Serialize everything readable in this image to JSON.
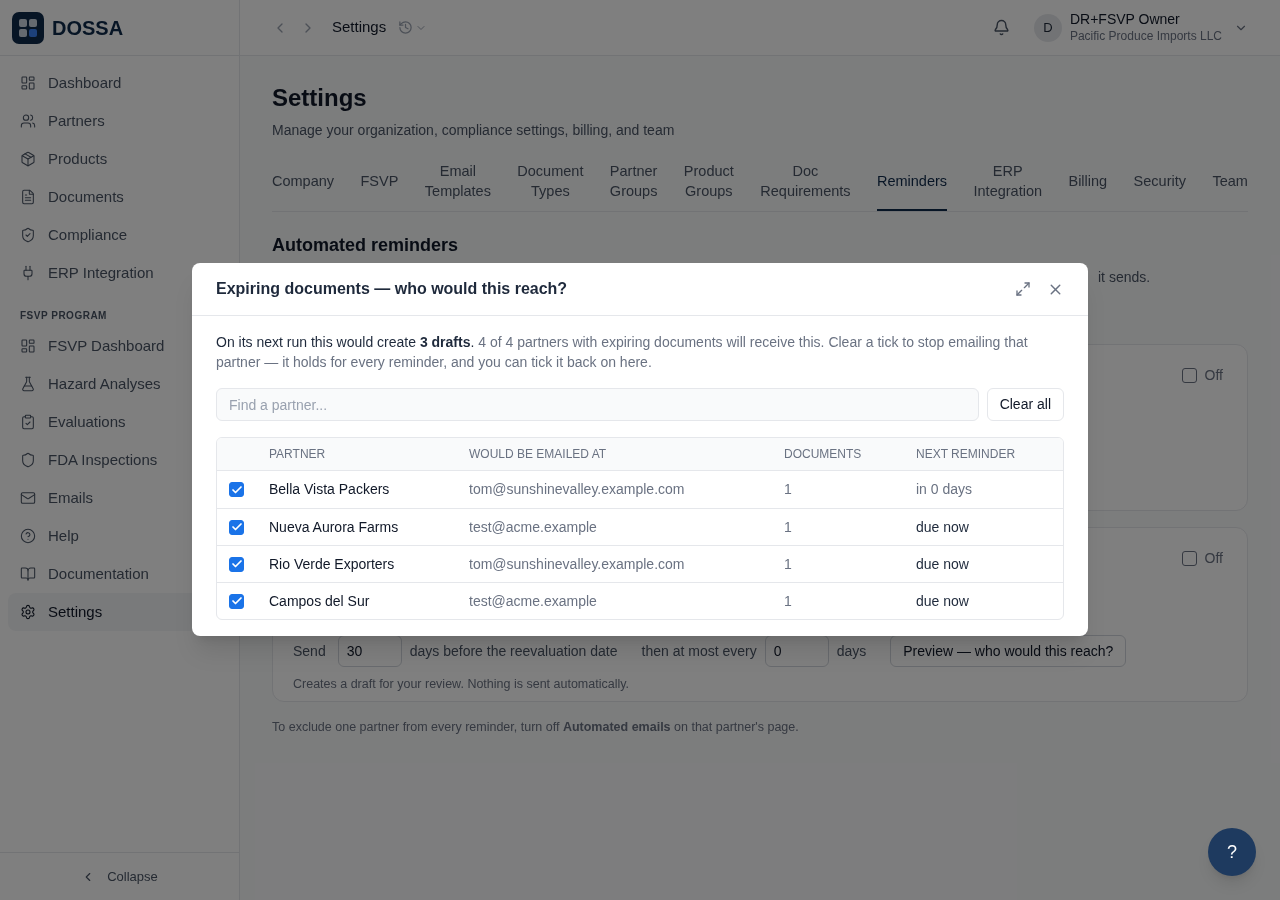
{
  "app": {
    "name": "DOSSA"
  },
  "sidebar": {
    "main_items": [
      {
        "label": "Dashboard",
        "selected": false
      },
      {
        "label": "Partners",
        "selected": false
      },
      {
        "label": "Products",
        "selected": false
      },
      {
        "label": "Documents",
        "selected": false
      },
      {
        "label": "Compliance",
        "selected": false
      },
      {
        "label": "ERP Integration",
        "selected": false
      }
    ],
    "section_heading": "FSVP PROGRAM",
    "program_items": [
      {
        "label": "FSVP Dashboard",
        "selected": false
      },
      {
        "label": "Hazard Analyses",
        "selected": false
      },
      {
        "label": "Evaluations",
        "selected": false
      },
      {
        "label": "FDA Inspections",
        "selected": false
      },
      {
        "label": "Emails",
        "selected": false
      },
      {
        "label": "Help",
        "selected": false
      },
      {
        "label": "Documentation",
        "selected": false
      },
      {
        "label": "Settings",
        "selected": true
      }
    ],
    "collapse_label": "Collapse"
  },
  "header": {
    "title": "Settings",
    "user": {
      "initial": "D",
      "name": "DR+FSVP Owner",
      "org": "Pacific Produce Imports LLC"
    }
  },
  "page": {
    "title": "Settings",
    "subtitle": "Manage your organization, compliance settings, billing, and team",
    "tabs": [
      {
        "label": "Company",
        "selected": false
      },
      {
        "label": "FSVP",
        "selected": false
      },
      {
        "label": "Email Templates",
        "selected": false
      },
      {
        "label": "Document Types",
        "selected": false
      },
      {
        "label": "Partner Groups",
        "selected": false
      },
      {
        "label": "Product Groups",
        "selected": false
      },
      {
        "label": "Doc Requirements",
        "selected": false
      },
      {
        "label": "Reminders",
        "selected": true
      },
      {
        "label": "ERP Integration",
        "selected": false
      },
      {
        "label": "Billing",
        "selected": false
      },
      {
        "label": "Security",
        "selected": false
      },
      {
        "label": "Team",
        "selected": false
      }
    ],
    "section_title": "Automated reminders",
    "section_description": "it sends.",
    "cards": [
      {
        "toggle_label": "Off",
        "on": false
      },
      {
        "toggle_label": "Off",
        "on": false,
        "send_label": "Send",
        "days_before": "30",
        "days_before_label": "days before the reevaluation date",
        "repeat_label": "then at most every",
        "repeat_days": "0",
        "repeat_unit": "days",
        "preview_button": "Preview — who would this reach?",
        "hint": "Creates a draft for your review. Nothing is sent automatically."
      }
    ],
    "footnote": "To exclude one partner from every reminder, turn off **Automated emails** on that partner's page."
  },
  "modal": {
    "title": "Expiring documents — who would this reach?",
    "summary_lead": "On its next run this would create **3 drafts**.",
    "summary_detail": "4 of 4 partners with expiring documents will receive this. Clear a tick to stop emailing that partner — it holds for every reminder, and you can tick it back on here.",
    "search": {
      "placeholder": "Find a partner..."
    },
    "clear_button": "Clear all",
    "columns": [
      "PARTNER",
      "WOULD BE EMAILED AT",
      "DOCUMENTS",
      "NEXT REMINDER"
    ],
    "rows": [
      {
        "checked": true,
        "partner": "Bella Vista Packers",
        "email": "tom@sunshinevalley.example.com",
        "documents": "1",
        "next_reminder": "in 0 days",
        "due": false
      },
      {
        "checked": true,
        "partner": "Nueva Aurora Farms",
        "email": "test@acme.example",
        "documents": "1",
        "next_reminder": "due now",
        "due": true
      },
      {
        "checked": true,
        "partner": "Rio Verde Exporters",
        "email": "tom@sunshinevalley.example.com",
        "documents": "1",
        "next_reminder": "due now",
        "due": true
      },
      {
        "checked": true,
        "partner": "Campos del Sur",
        "email": "test@acme.example",
        "documents": "1",
        "next_reminder": "due now",
        "due": true
      }
    ]
  },
  "help_button": "?"
}
